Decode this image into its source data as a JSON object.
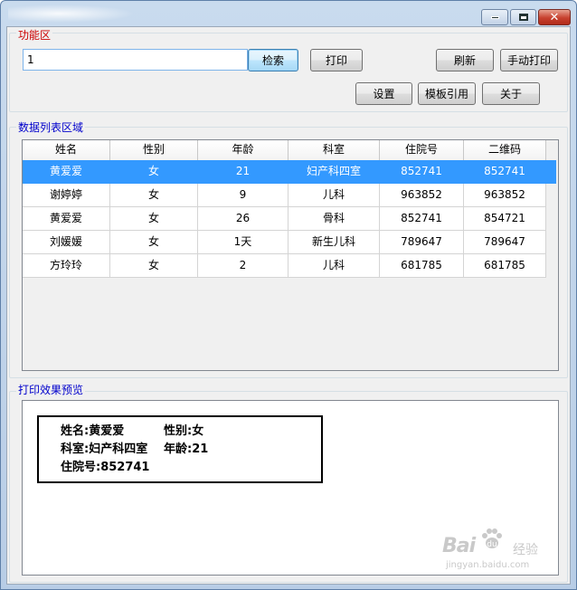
{
  "window": {
    "controls": {
      "minimize": "minimize-icon",
      "maximize": "maximize-icon",
      "close": "close-icon"
    }
  },
  "function_area": {
    "label": "功能区",
    "label_color": "#cc0000",
    "search_value": "1",
    "search_button": "检索",
    "print_button": "打印",
    "refresh_button": "刷新",
    "manual_print_button": "手动打印",
    "settings_button": "设置",
    "template_button": "模板引用",
    "about_button": "关于"
  },
  "list_area": {
    "label": "数据列表区域",
    "label_color": "#0000cc",
    "columns": [
      "姓名",
      "性别",
      "年龄",
      "科室",
      "住院号",
      "二维码"
    ],
    "selected_row": 0,
    "selection_color": "#3399ff",
    "rows": [
      [
        "黄爱爱",
        "女",
        "21",
        "妇产科四室",
        "852741",
        "852741"
      ],
      [
        "谢婷婷",
        "女",
        "9",
        "儿科",
        "963852",
        "963852"
      ],
      [
        "黄爱爱",
        "女",
        "26",
        "骨科",
        "852741",
        "854721"
      ],
      [
        "刘媛媛",
        "女",
        "1天",
        "新生儿科",
        "789647",
        "789647"
      ],
      [
        "方玲玲",
        "女",
        "2",
        "儿科",
        "681785",
        "681785"
      ]
    ]
  },
  "preview_area": {
    "label": "打印效果预览",
    "label_color": "#0000cc",
    "card": {
      "name": "姓名:黄爱爱",
      "gender": "性别:女",
      "department": "科室:妇产科四室",
      "age": "年龄:21",
      "admission_no": "住院号:852741"
    }
  },
  "watermark": {
    "brand": "Bai",
    "brand_suffix": "经验",
    "url": "jingyan.baidu.com",
    "icon": "paw-icon"
  }
}
